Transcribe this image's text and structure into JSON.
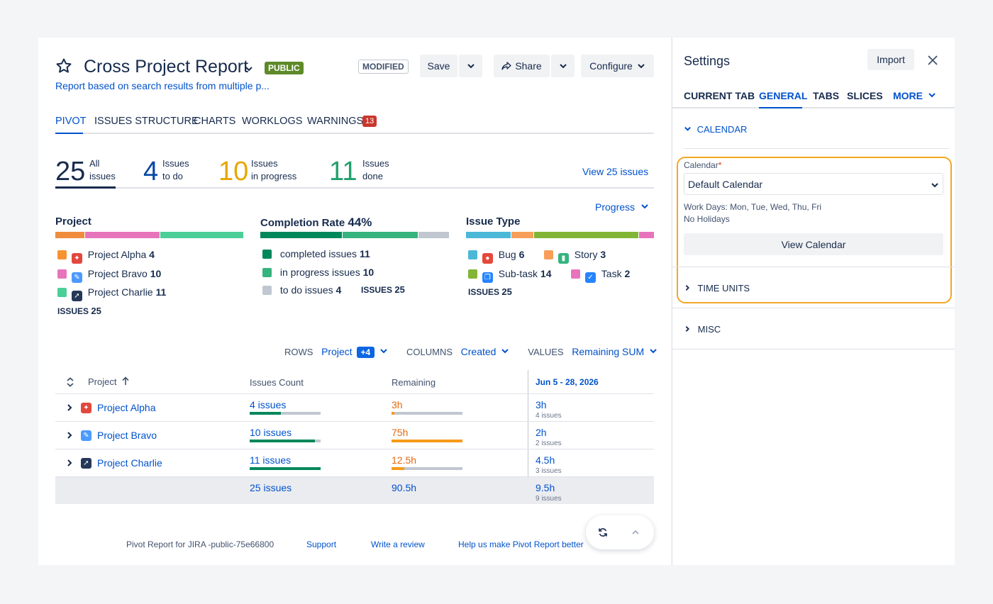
{
  "report": {
    "title": "Cross Project Report",
    "public_badge": "PUBLIC",
    "modified_badge": "MODIFIED",
    "subtitle": "Report based on search results from multiple p...",
    "save_label": "Save",
    "share_label": "Share",
    "configure_label": "Configure"
  },
  "tabs": [
    {
      "label": "PIVOT"
    },
    {
      "label": "ISSUES STRUCTURE"
    },
    {
      "label": "CHARTS"
    },
    {
      "label": "WORKLOGS"
    },
    {
      "label": "WARNINGS",
      "count": "13"
    }
  ],
  "stats": {
    "all": {
      "value": "25",
      "line1": "All",
      "line2": "issues"
    },
    "todo": {
      "value": "4",
      "line1": "Issues",
      "line2": "to do"
    },
    "progress": {
      "value": "10",
      "line1": "Issues",
      "line2": "in progress"
    },
    "done": {
      "value": "11",
      "line1": "Issues",
      "line2": "done"
    },
    "view_link": "View 25 issues"
  },
  "progress_dropdown": "Progress",
  "project_summary": {
    "title": "Project",
    "items": [
      {
        "name": "Project Alpha",
        "count": "4",
        "color": "#f79233"
      },
      {
        "name": "Project Bravo",
        "count": "10",
        "color": "#e774bb"
      },
      {
        "name": "Project Charlie",
        "count": "11",
        "color": "#4bce97"
      }
    ],
    "issues_label": "ISSUES",
    "issues_total": "25"
  },
  "completion": {
    "title": "Completion Rate",
    "rate": "44%",
    "items": [
      {
        "label": "completed issues",
        "count": "11",
        "color": "#00875a"
      },
      {
        "label": "in progress issues",
        "count": "10",
        "color": "#36b37e"
      },
      {
        "label": "to do issues",
        "count": "4",
        "color": "#c1c7d0"
      }
    ],
    "issues_label": "ISSUES",
    "issues_total": "25"
  },
  "issue_type": {
    "title": "Issue Type",
    "items": [
      {
        "name": "Bug",
        "count": "6",
        "color": "#4bb8d8"
      },
      {
        "name": "Story",
        "count": "3",
        "color": "#f79f5a"
      },
      {
        "name": "Sub-task",
        "count": "14",
        "color": "#82b536"
      },
      {
        "name": "Task",
        "count": "2",
        "color": "#e774bb"
      }
    ],
    "issues_label": "ISSUES",
    "issues_total": "25"
  },
  "config_bar": {
    "rows_label": "ROWS",
    "rows_value": "Project",
    "rows_extra": "+4",
    "columns_label": "COLUMNS",
    "columns_value": "Created",
    "values_label": "VALUES",
    "values_value": "Remaining SUM"
  },
  "table": {
    "headers": {
      "project": "Project",
      "count": "Issues Count",
      "remaining": "Remaining",
      "period": "Jun 5 - 28, 2026"
    },
    "rows": [
      {
        "project": "Project Alpha",
        "count": "4 issues",
        "count_frac": 0.44,
        "remaining": "3h",
        "remaining_frac": 0.04,
        "period": "3h",
        "period_sub": "4 issues"
      },
      {
        "project": "Project Bravo",
        "count": "10 issues",
        "count_frac": 0.92,
        "remaining": "75h",
        "remaining_frac": 1.0,
        "period": "2h",
        "period_sub": "2 issues"
      },
      {
        "project": "Project Charlie",
        "count": "11 issues",
        "count_frac": 1.0,
        "remaining": "12.5h",
        "remaining_frac": 0.18,
        "period": "4.5h",
        "period_sub": "3 issues"
      }
    ],
    "total": {
      "count": "25 issues",
      "remaining": "90.5h",
      "period": "9.5h",
      "period_sub": "9 issues"
    }
  },
  "footer": {
    "version": "Pivot Report for JIRA -public-75e66800",
    "support": "Support",
    "review": "Write a review",
    "help": "Help us make Pivot Report better"
  },
  "settings": {
    "title": "Settings",
    "import_label": "Import",
    "tabs": [
      "CURRENT TAB",
      "GENERAL",
      "TABS",
      "SLICES",
      "MORE"
    ],
    "calendar_section": "CALENDAR",
    "calendar_label": "Calendar",
    "calendar_value": "Default Calendar",
    "work_days": "Work Days: Mon, Tue, Wed, Thu, Fri",
    "holidays": "No Holidays",
    "view_calendar": "View Calendar",
    "time_units": "TIME UNITS",
    "misc": "MISC"
  }
}
